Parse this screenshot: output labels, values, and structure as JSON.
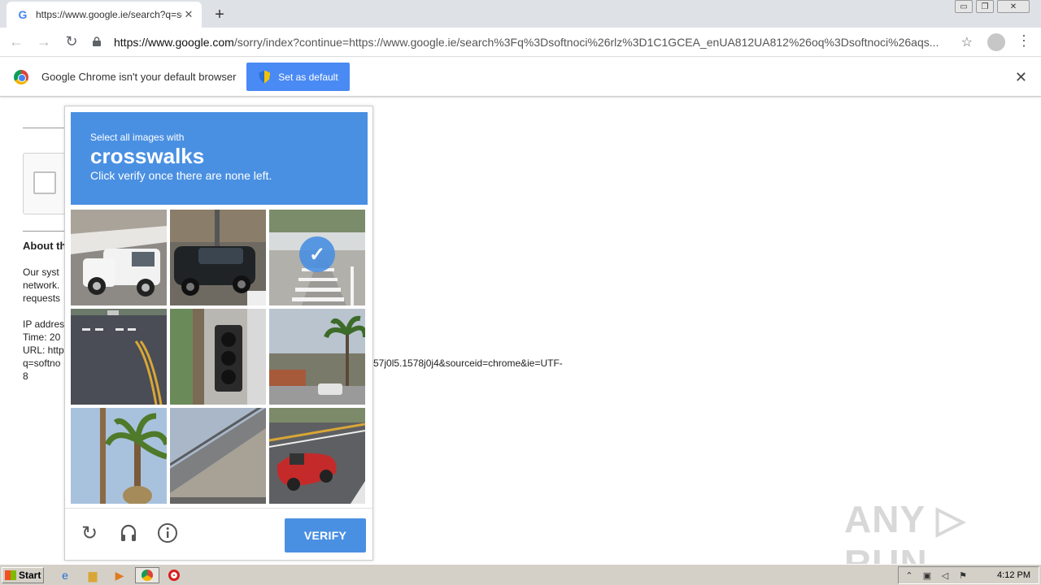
{
  "tab": {
    "favicon": "G",
    "title": "https://www.google.ie/search?q=softnoci",
    "close": "✕",
    "new_tab": "+"
  },
  "window": {
    "minimize": "▭",
    "restore": "❐",
    "close": "✕"
  },
  "toolbar": {
    "back": "←",
    "forward": "→",
    "reload": "↻",
    "url_host": "https://www.google.com",
    "url_path": "/sorry/index?continue=https://www.google.ie/search%3Fq%3Dsoftnoci%26rlz%3D1C1GCEA_enUA812UA812%26oq%3Dsoftnoci%26aqs...",
    "star": "☆",
    "menu": "⋮"
  },
  "infobar": {
    "message": "Google Chrome isn't your default browser",
    "button_label": "Set as default",
    "close": "✕"
  },
  "sorry_page": {
    "about_heading": "About th",
    "para1_lines": [
      "Our syst",
      "network.",
      "requests"
    ],
    "para2_lines": [
      "IP addres",
      "Time: 20",
      "URL: http",
      "q=softno",
      "8"
    ],
    "url_tail": "57j0l5.1578j0j4&sourceid=chrome&ie=UTF-"
  },
  "captcha": {
    "instruction_small": "Select all images with",
    "target": "crosswalks",
    "hint": "Click verify once there are none left.",
    "verify_label": "VERIFY",
    "tiles": [
      {
        "name": "white-truck",
        "selected": false
      },
      {
        "name": "black-suv",
        "selected": false
      },
      {
        "name": "crosswalk-road",
        "selected": true
      },
      {
        "name": "intersection-road",
        "selected": false
      },
      {
        "name": "traffic-light",
        "selected": false
      },
      {
        "name": "palm-street",
        "selected": false
      },
      {
        "name": "palm-tree",
        "selected": false
      },
      {
        "name": "overpass",
        "selected": false
      },
      {
        "name": "red-convertible",
        "selected": false
      }
    ],
    "accent_color": "#4a90e2"
  },
  "watermark": "ANY ▷ RUN",
  "taskbar": {
    "start_label": "Start",
    "clock": "4:12 PM"
  }
}
